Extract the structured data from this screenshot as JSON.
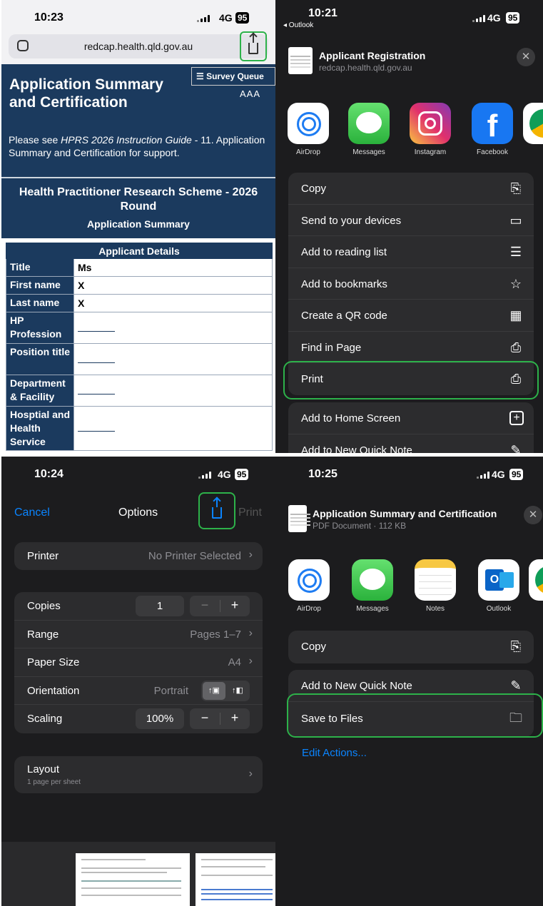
{
  "q1": {
    "status": {
      "time": "10:23",
      "network": "4G",
      "battery": "95"
    },
    "url": "redcap.health.qld.gov.au",
    "survey_queue": "Survey Queue",
    "text_size": "AAA",
    "title_line1": "Application Summary",
    "title_line2": "and Certification",
    "note_prefix": "Please see ",
    "note_italic": "HPRS 2026 Instruction Guide",
    "note_suffix": " - 11. Application Summary and Certification for support.",
    "scheme_heading": "Health Practitioner Research Scheme - 2026 Round",
    "scheme_sub": "Application Summary",
    "table_header": "Applicant Details",
    "rows": [
      {
        "label": "Title",
        "value": "Ms"
      },
      {
        "label": "First name",
        "value": "X"
      },
      {
        "label": "Last name",
        "value": "X"
      },
      {
        "label": "HP Profession",
        "value": ""
      },
      {
        "label": "Position title",
        "value": ""
      },
      {
        "label": "Department & Facility",
        "value": ""
      },
      {
        "label": "Hosptial and Health Service",
        "value": ""
      }
    ]
  },
  "q2": {
    "status": {
      "time": "10:21",
      "back": "◂ Outlook",
      "network": "4G",
      "battery": "95"
    },
    "header_title": "Applicant Registration",
    "header_sub": "redcap.health.qld.gov.au",
    "close": "✕",
    "apps": [
      {
        "name": "AirDrop",
        "icon": "airdrop-icon"
      },
      {
        "name": "Messages",
        "icon": "messages-icon"
      },
      {
        "name": "Instagram",
        "icon": "instagram-icon"
      },
      {
        "name": "Facebook",
        "icon": "facebook-icon",
        "glyph": "f"
      },
      {
        "name": "C",
        "icon": "chrome-icon"
      }
    ],
    "actions": [
      {
        "label": "Copy",
        "icon": "copy-icon",
        "glyph": "⎘"
      },
      {
        "label": "Send to your devices",
        "icon": "devices-icon",
        "glyph": "▭"
      },
      {
        "label": "Add to reading list",
        "icon": "reading-list-icon",
        "glyph": "☰"
      },
      {
        "label": "Add to bookmarks",
        "icon": "star-icon",
        "glyph": "☆"
      },
      {
        "label": "Create a QR code",
        "icon": "qr-icon",
        "glyph": "▦"
      },
      {
        "label": "Find in Page",
        "icon": "find-icon",
        "glyph": "⎙"
      },
      {
        "label": "Print",
        "icon": "printer-icon",
        "glyph": "⎙"
      }
    ],
    "actions2": [
      {
        "label": "Add to Home Screen",
        "icon": "add-square-icon",
        "glyph": "+"
      },
      {
        "label": "Add to New Quick Note",
        "icon": "quick-note-icon",
        "glyph": "✎"
      }
    ]
  },
  "q3": {
    "status": {
      "time": "10:24",
      "network": "4G",
      "battery": "95"
    },
    "cancel": "Cancel",
    "title": "Options",
    "print": "Print",
    "printer_label": "Printer",
    "printer_value": "No Printer Selected",
    "copies_label": "Copies",
    "copies_value": "1",
    "range_label": "Range",
    "range_value": "Pages 1–7",
    "paper_label": "Paper Size",
    "paper_value": "A4",
    "orientation_label": "Orientation",
    "orientation_value": "Portrait",
    "scaling_label": "Scaling",
    "scaling_value": "100%",
    "layout_label": "Layout",
    "layout_sub": "1 page per sheet",
    "minus": "−",
    "plus": "+",
    "chevron": "›"
  },
  "q4": {
    "status": {
      "time": "10:25",
      "network": "4G",
      "battery": "95"
    },
    "header_title": "Application Summary and Certification",
    "header_sub": "PDF Document · 112 KB",
    "close": "✕",
    "apps": [
      {
        "name": "AirDrop",
        "icon": "airdrop-icon"
      },
      {
        "name": "Messages",
        "icon": "messages-icon"
      },
      {
        "name": "Notes",
        "icon": "notes-icon"
      },
      {
        "name": "Outlook",
        "icon": "outlook-icon"
      },
      {
        "name": "C",
        "icon": "chrome-icon"
      }
    ],
    "copy": "Copy",
    "quick_note": "Add to New Quick Note",
    "save_files": "Save to Files",
    "edit_actions": "Edit Actions..."
  },
  "colors": {
    "highlight": "#2db24a",
    "ios_blue": "#0a84ff",
    "redcap_navy": "#1b3a5e"
  }
}
